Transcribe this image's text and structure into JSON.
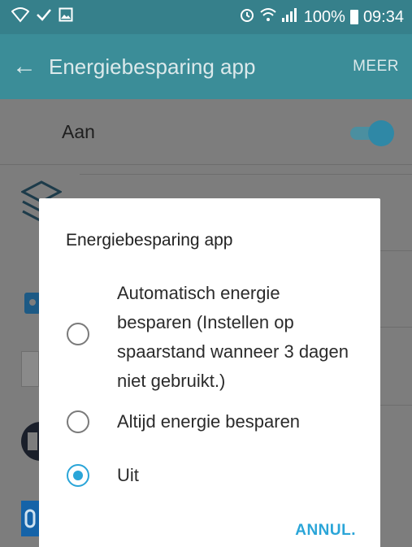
{
  "status_bar": {
    "left_icons": [
      "wifi-check-icon",
      "check-icon",
      "image-icon"
    ],
    "right_icons": [
      "alarm-icon",
      "wifi-icon",
      "signal-icon"
    ],
    "battery": "100%",
    "time": "09:34"
  },
  "app_bar": {
    "title": "Energiebesparing app",
    "more": "MEER"
  },
  "settings": {
    "on_label": "Aan",
    "on_state": true
  },
  "dialog": {
    "title": "Energiebesparing app",
    "options": [
      {
        "label": "Automatisch energie besparen (Instellen op spaarstand wanneer 3 dagen niet gebruikt.)",
        "selected": false
      },
      {
        "label": "Altijd energie besparen",
        "selected": false
      },
      {
        "label": "Uit",
        "selected": true
      }
    ],
    "cancel": "ANNUL."
  },
  "colors": {
    "status_bar": "#36808b",
    "app_bar": "#3b8d98",
    "accent": "#2aa5d8"
  }
}
